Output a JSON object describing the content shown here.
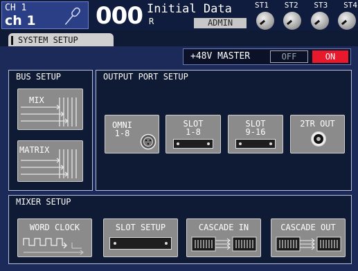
{
  "header": {
    "channel_number": "CH 1",
    "channel_name": "ch 1",
    "mic_icon": "microphone-icon",
    "scene_number": "000",
    "scene_title": "Initial Data",
    "scene_flag": "R",
    "user": "ADMIN",
    "stereo_labels": [
      "ST1",
      "ST2",
      "ST3",
      "ST4"
    ]
  },
  "tab": {
    "label": "SYSTEM SETUP"
  },
  "phantom": {
    "label": "+48V MASTER",
    "off_label": "OFF",
    "on_label": "ON",
    "state": "ON",
    "on_color": "#e8192c"
  },
  "bus_setup": {
    "title": "BUS SETUP",
    "mix_label": "MIX",
    "matrix_label": "MATRIX"
  },
  "output_port_setup": {
    "title": "OUTPUT PORT SETUP",
    "omni_label_1": "OMNI",
    "omni_label_2": "1-8",
    "slot1_label_1": "SLOT",
    "slot1_label_2": "1-8",
    "slot2_label_1": "SLOT",
    "slot2_label_2": "9-16",
    "twotr_label": "2TR OUT"
  },
  "mixer_setup": {
    "title": "MIXER SETUP",
    "word_clock_label": "WORD CLOCK",
    "slot_setup_label": "SLOT SETUP",
    "cascade_in_label": "CASCADE IN",
    "cascade_out_label": "CASCADE OUT"
  }
}
